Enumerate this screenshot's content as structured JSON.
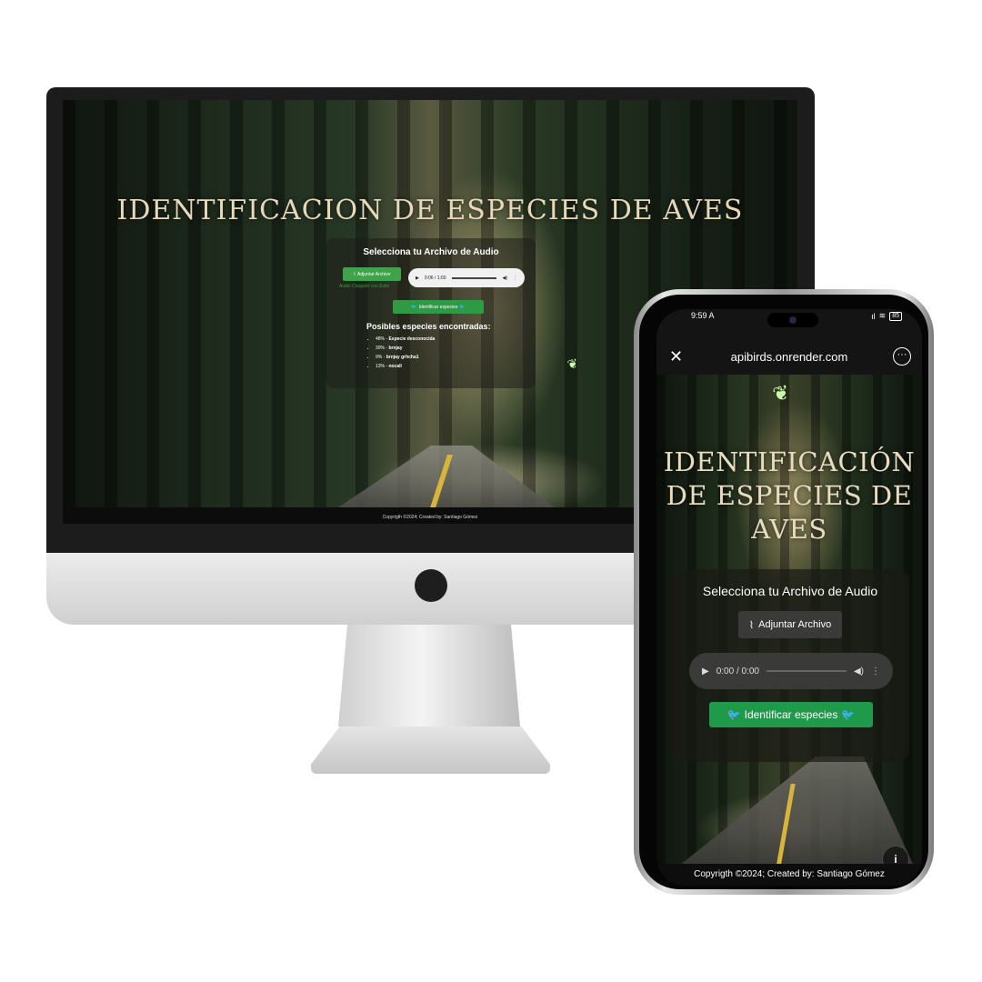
{
  "desktop": {
    "title": "IDENTIFICACION DE ESPECIES DE AVES",
    "card_title": "Selecciona tu Archivo de Audio",
    "attach_label": "Adjuntar Archivo",
    "audio_time": "0:06 / 1:00",
    "loaded_message": "Audio Cargado con Éxito",
    "identify_label": "Identificar especies",
    "results_title": "Posibles especies encontradas:",
    "results": [
      {
        "percent": "48%",
        "name": "Especie desconocida"
      },
      {
        "percent": "30%",
        "name": "brnjay"
      },
      {
        "percent": "9%",
        "name": "brnjay grhcha1"
      },
      {
        "percent": "13%",
        "name": "nocall"
      }
    ],
    "copyright": "Copyrigth ©2024; Created by: Santiago Gómez"
  },
  "phone": {
    "status_time": "9:59 A",
    "battery": "85",
    "url": "apibirds.onrender.com",
    "title": "IDENTIFICACIÓN DE ESPECIES DE AVES",
    "card_title": "Selecciona tu Archivo de Audio",
    "attach_label": "Adjuntar Archivo",
    "audio_time": "0:00 / 0:00",
    "identify_label": "Identificar especies",
    "copyright": "Copyrigth ©2024; Created by: Santiago Gómez"
  },
  "icons": {
    "attach": "paperclip-icon",
    "play": "play-icon",
    "volume": "volume-icon",
    "more": "more-vertical-icon",
    "bird": "bird-icon",
    "close": "close-icon",
    "menu": "more-horizontal-icon",
    "info": "info-icon"
  },
  "colors": {
    "attach_green": "#3fa34a",
    "identify_green": "#1f9a4a",
    "title_gold": "#e6d8b8"
  }
}
